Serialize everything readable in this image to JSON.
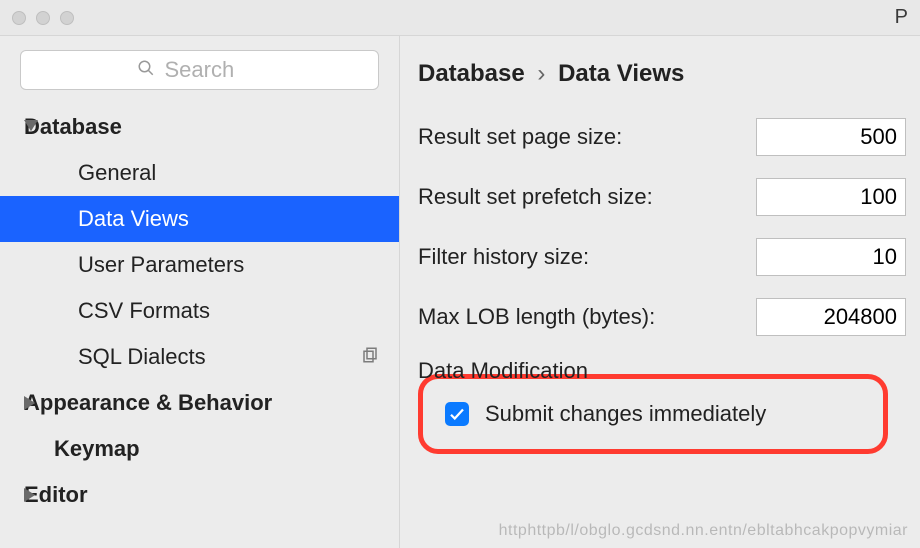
{
  "window": {
    "title_fragment": "P"
  },
  "search": {
    "placeholder": "Search"
  },
  "sidebar": {
    "sections": [
      {
        "label": "Database",
        "expanded": true,
        "items": [
          {
            "label": "General"
          },
          {
            "label": "Data Views",
            "selected": true
          },
          {
            "label": "User Parameters"
          },
          {
            "label": "CSV Formats"
          },
          {
            "label": "SQL Dialects",
            "has_copy_action": true
          }
        ]
      },
      {
        "label": "Appearance & Behavior",
        "expanded": false
      },
      {
        "label": "Keymap",
        "leaf": true
      },
      {
        "label": "Editor",
        "expanded": false
      }
    ]
  },
  "breadcrumb": {
    "parent": "Database",
    "child": "Data Views"
  },
  "fields": {
    "page_size": {
      "label": "Result set page size:",
      "value": "500"
    },
    "prefetch_size": {
      "label": "Result set prefetch size:",
      "value": "100"
    },
    "filter_history": {
      "label": "Filter history size:",
      "value": "10"
    },
    "max_lob": {
      "label": "Max LOB length (bytes):",
      "value": "204800"
    }
  },
  "group": {
    "title": "Data Modification"
  },
  "submit_changes": {
    "label": "Submit changes immediately",
    "checked": true
  },
  "watermark": "httphttpb/l/obglo.gcdsnd.nn.entn/ebltabhcakpopvymiar"
}
